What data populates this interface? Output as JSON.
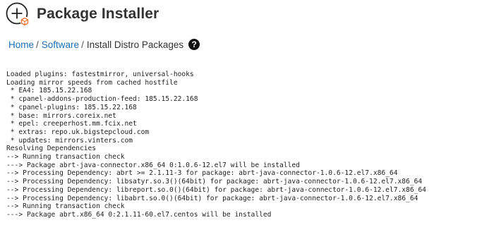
{
  "page": {
    "title": "Package Installer"
  },
  "breadcrumb": {
    "home": "Home",
    "software": "Software",
    "separator": "/",
    "current": "Install Distro Packages",
    "help_icon": "?"
  },
  "icons": {
    "app_icon": "add-package-icon",
    "help_icon": "question-circle-icon"
  },
  "colors": {
    "link": "#1a6fb5",
    "icon_accent": "#e8722a",
    "text": "#333333"
  },
  "terminal": {
    "lines": [
      "Loaded plugins: fastestmirror, universal-hooks",
      "Loading mirror speeds from cached hostfile",
      " * EA4: 185.15.22.168",
      " * cpanel-addons-production-feed: 185.15.22.168",
      " * cpanel-plugins: 185.15.22.168",
      " * base: mirrors.coreix.net",
      " * epel: creeperhost.mm.fcix.net",
      " * extras: repo.uk.bigstepcloud.com",
      " * updates: mirrors.vinters.com",
      "Resolving Dependencies",
      "--> Running transaction check",
      "---> Package abrt-java-connector.x86_64 0:1.0.6-12.el7 will be installed",
      "--> Processing Dependency: abrt >= 2.1.11-3 for package: abrt-java-connector-1.0.6-12.el7.x86_64",
      "--> Processing Dependency: libsatyr.so.3()(64bit) for package: abrt-java-connector-1.0.6-12.el7.x86_64",
      "--> Processing Dependency: libreport.so.0()(64bit) for package: abrt-java-connector-1.0.6-12.el7.x86_64",
      "--> Processing Dependency: libabrt.so.0()(64bit) for package: abrt-java-connector-1.0.6-12.el7.x86_64",
      "--> Running transaction check",
      "---> Package abrt.x86_64 0:2.1.11-60.el7.centos will be installed"
    ]
  }
}
